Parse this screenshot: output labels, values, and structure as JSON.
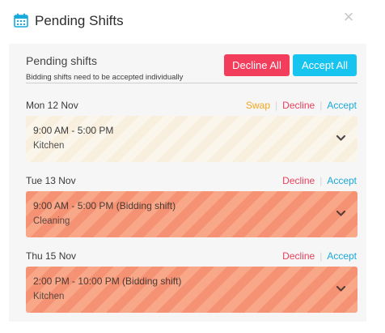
{
  "header": {
    "title": "Pending Shifts",
    "close_symbol": "×"
  },
  "pending": {
    "heading": "Pending shifts",
    "subtitle": "Bidding shifts need to be accepted individually",
    "decline_all_label": "Decline All",
    "accept_all_label": "Accept All"
  },
  "colors": {
    "decline": "#f23d5c",
    "accept": "#17c3ef",
    "swap": "#f2a61e",
    "bidding_card": "#f59274",
    "normal_card": "#f8efde"
  },
  "icons": {
    "header": "calendar-icon",
    "close": "close-icon",
    "expand": "chevron-down-icon"
  },
  "days": [
    {
      "date": "Mon 12 Nov",
      "swap_label": "Swap",
      "decline_label": "Decline",
      "accept_label": "Accept",
      "shift": {
        "time": "9:00 AM - 5:00 PM",
        "place": "Kitchen",
        "bidding": false
      }
    },
    {
      "date": "Tue 13 Nov",
      "decline_label": "Decline",
      "accept_label": "Accept",
      "shift": {
        "time": "9:00 AM - 5:00 PM (Bidding shift)",
        "place": "Cleaning",
        "bidding": true
      }
    },
    {
      "date": "Thu 15 Nov",
      "decline_label": "Decline",
      "accept_label": "Accept",
      "shift": {
        "time": "2:00 PM - 10:00 PM (Bidding shift)",
        "place": "Kitchen",
        "bidding": true
      }
    }
  ]
}
